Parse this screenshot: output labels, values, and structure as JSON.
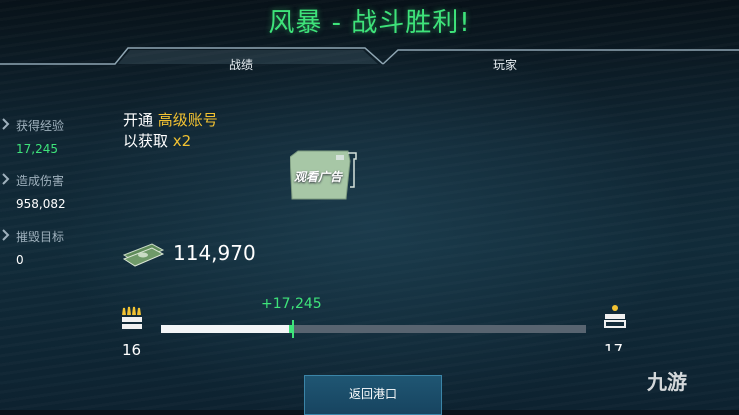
{
  "header": {
    "title": "风暴 - 战斗胜利!"
  },
  "tabs": [
    {
      "label": "战绩"
    },
    {
      "label": "玩家"
    }
  ],
  "stats": [
    {
      "label": "获得经验",
      "value": "17,245",
      "value_color": "#3ee37a"
    },
    {
      "label": "造成伤害",
      "value": "958,082",
      "value_color": "#ffffff"
    },
    {
      "label": "摧毁目标",
      "value": "0",
      "value_color": "#ffffff"
    }
  ],
  "premium": {
    "line1_prefix": "开通",
    "line1_highlight": "高级账号",
    "line2_prefix": "以获取",
    "line2_highlight": "x2"
  },
  "ad": {
    "label": "观看广告"
  },
  "cash": {
    "amount": "114,970",
    "icon": "cash-stack-icon"
  },
  "progress": {
    "gain_label": "+17,245",
    "current_level": "16",
    "next_level": "17",
    "before_fraction": 0.3,
    "after_fraction": 0.31
  },
  "footer": {
    "return_label": "返回港口"
  },
  "watermark": {
    "text": "九游"
  },
  "colors": {
    "accent_green": "#3ee37a",
    "gold": "#f2c232",
    "button_blue": "#1f5673"
  }
}
